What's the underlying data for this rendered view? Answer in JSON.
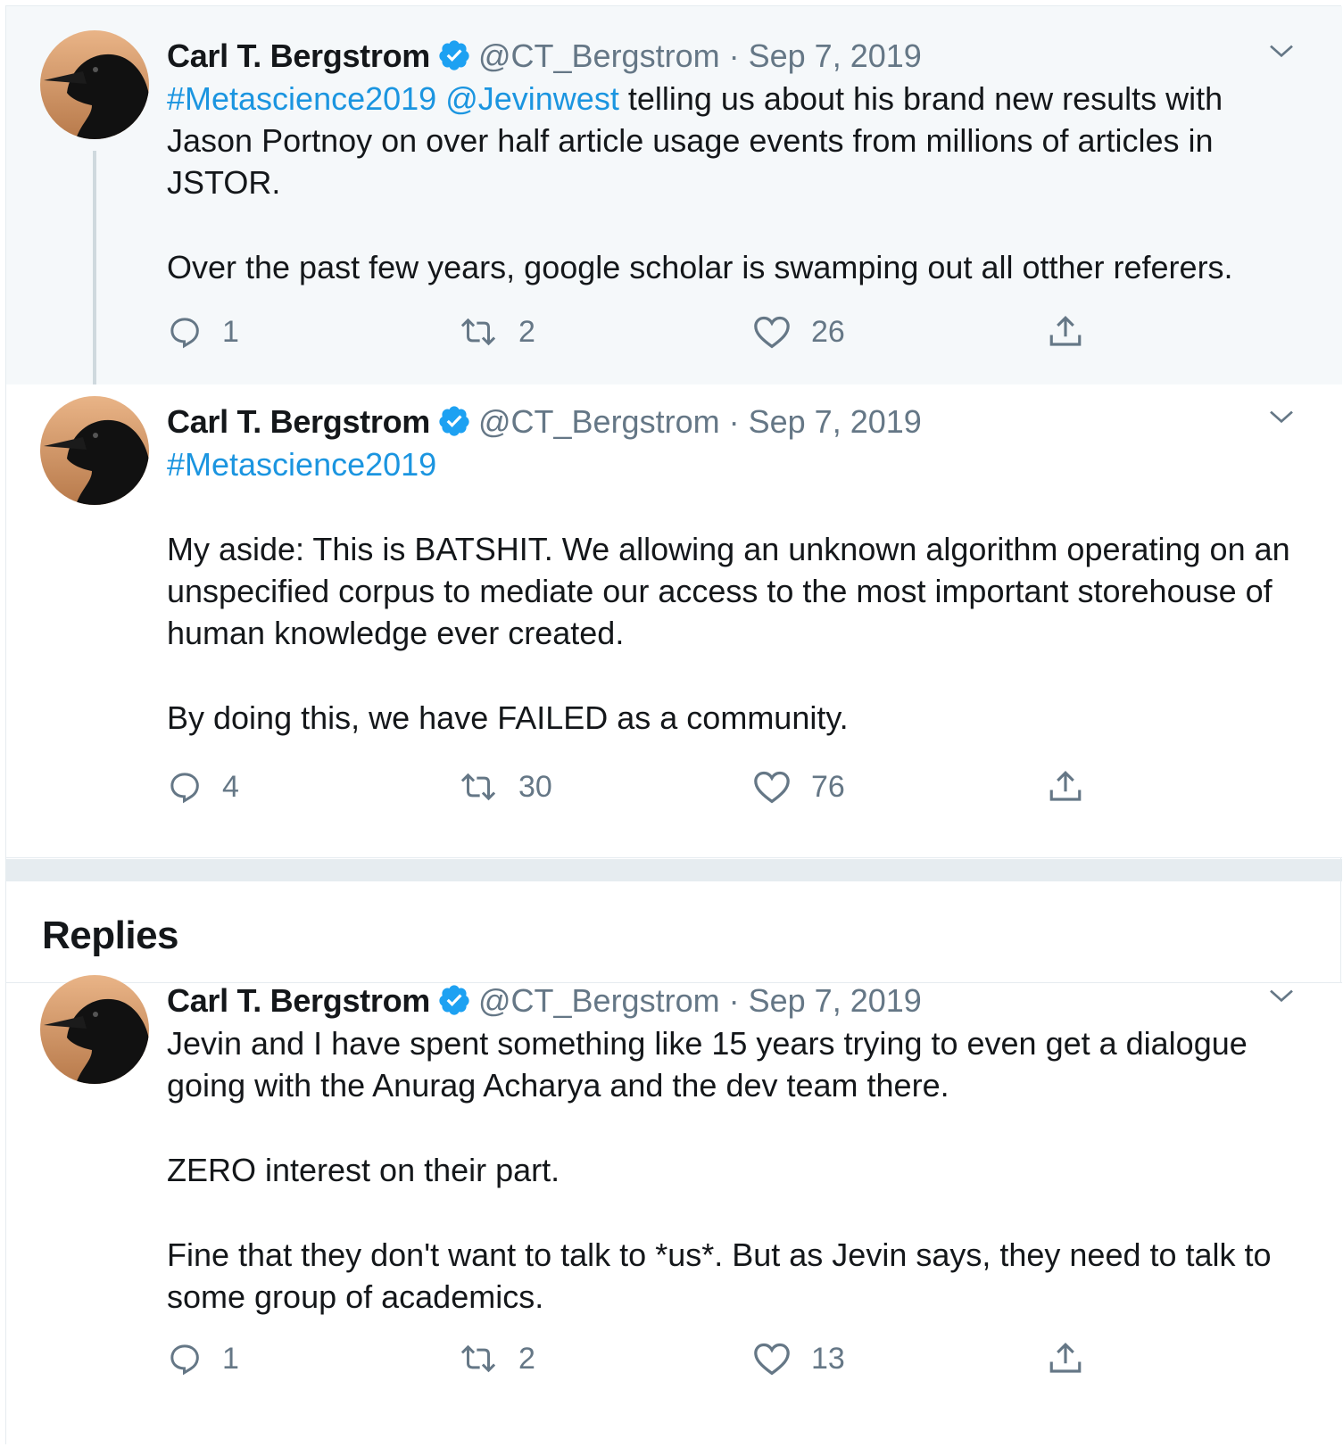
{
  "author": {
    "name": "Carl T. Bergstrom",
    "handle": "@CT_Bergstrom",
    "separator": "·"
  },
  "tweets": [
    {
      "date": "Sep 7, 2019",
      "hashtag": "#Metascience2019",
      "mention": "@Jevinwest",
      "text_p1_rest": " telling us about his brand new results with Jason Portnoy on over half article usage events  from millions of articles in JSTOR.",
      "text_p2": "Over the past few years, google scholar is swamping out all otther referers.",
      "replies": "1",
      "retweets": "2",
      "likes": "26"
    },
    {
      "date": "Sep 7, 2019",
      "hashtag": "#Metascience2019",
      "text_p2": "My aside: This is BATSHIT. We allowing an unknown algorithm operating on an unspecified corpus to mediate our access to the most important storehouse of human knowledge ever created.",
      "text_p3": "By doing this, we have FAILED as a community.",
      "replies": "4",
      "retweets": "30",
      "likes": "76"
    },
    {
      "date": "Sep 7, 2019",
      "text_p1": "Jevin and I have spent something like 15 years trying to even get a dialogue going with the Anurag Acharya and the dev team there.",
      "text_p2": "ZERO interest on their part.",
      "text_p3": "Fine that they don't want to talk to *us*. But as Jevin says, they need to talk to some group of academics.",
      "replies": "1",
      "retweets": "2",
      "likes": "13"
    }
  ],
  "replies_section": {
    "title": "Replies"
  },
  "icons": {
    "reply": "reply-icon",
    "retweet": "retweet-icon",
    "like": "heart-icon",
    "share": "share-icon",
    "verified": "verified-badge-icon",
    "menu": "chevron-down-icon"
  },
  "colors": {
    "link": "#1b95e0",
    "verified": "#1da1f2",
    "muted": "#657786",
    "highlight_bg": "#f5f8fa"
  }
}
